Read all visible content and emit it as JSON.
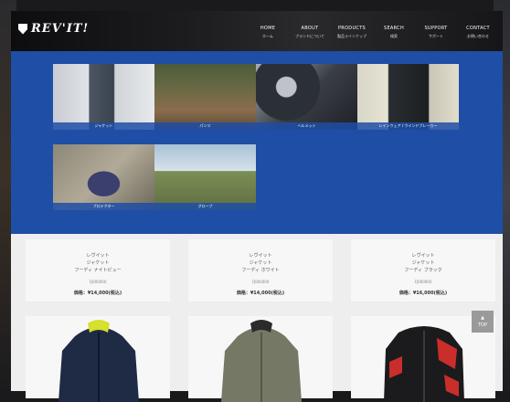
{
  "brand": {
    "logo_text": "REV'IT!"
  },
  "nav": [
    {
      "en": "HOME",
      "ja": "ホーム"
    },
    {
      "en": "ABOUT",
      "ja": "ブランドについて"
    },
    {
      "en": "PRODUCTS",
      "ja": "製品ラインナップ"
    },
    {
      "en": "SEARCH",
      "ja": "検索"
    },
    {
      "en": "SUPPORT",
      "ja": "サポート"
    },
    {
      "en": "CONTACT",
      "ja": "お問い合わせ"
    }
  ],
  "categories": [
    {
      "label": "ジャケット"
    },
    {
      "label": "パンツ"
    },
    {
      "label": "ヘルメット"
    },
    {
      "label": "レインウェア / ウインドブレーカー"
    },
    {
      "label": "プロテクター"
    },
    {
      "label": "グローブ"
    }
  ],
  "products": [
    {
      "title": "レヴイット\nジャケット\nフーディ ナイトビュー",
      "sub": "FJ000000",
      "price": "価格：¥14,000(税込)"
    },
    {
      "title": "レヴイット\nジャケット\nフーディ ホワイト",
      "sub": "FJ000000",
      "price": "価格：¥14,000(税込)"
    },
    {
      "title": "レヴイット\nジャケット\nフーディ ブラック",
      "sub": "FJ000000",
      "price": "価格：¥16,000(税込)"
    }
  ],
  "scroll_top": {
    "label": "TOP"
  },
  "colors": {
    "menu_blue": "#1e4ea6",
    "accent_yellow": "#e4e53a",
    "accent_red": "#d7312c"
  }
}
